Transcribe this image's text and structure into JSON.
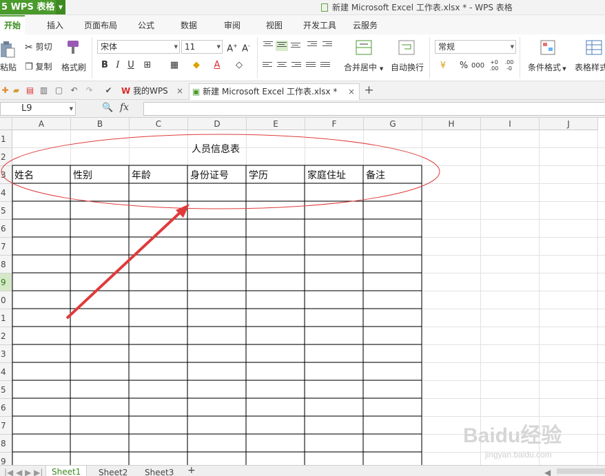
{
  "app": {
    "name": "WPS 表格",
    "window_title": "新建 Microsoft Excel 工作表.xlsx * - WPS 表格"
  },
  "menu": {
    "tabs": [
      "开始",
      "插入",
      "页面布局",
      "公式",
      "数据",
      "审阅",
      "视图",
      "开发工具",
      "云服务"
    ]
  },
  "ribbon": {
    "paste_label": "粘贴",
    "cut_label": "剪切",
    "copy_label": "复制",
    "format_painter_label": "格式刷",
    "font_name": "宋体",
    "font_size": "11",
    "bold": "B",
    "italic": "I",
    "underline": "U",
    "merge_center_label": "合并居中",
    "wrap_text_label": "自动换行",
    "number_format": "常规",
    "percent": "%",
    "conditional_format_label": "条件格式",
    "table_style_label": "表格样式"
  },
  "doc_tabs": {
    "my_wps": "我的WPS",
    "active_doc": "新建 Microsoft Excel 工作表.xlsx *"
  },
  "formula_bar": {
    "cell_ref": "L9",
    "fx": "fx",
    "formula": ""
  },
  "sheet": {
    "columns": [
      "A",
      "B",
      "C",
      "D",
      "E",
      "F",
      "G",
      "H",
      "I",
      "J"
    ],
    "rows": [
      "1",
      "2",
      "3",
      "4",
      "5",
      "6",
      "7",
      "8",
      "9",
      "0",
      "1",
      "2",
      "3",
      "4",
      "5",
      "6",
      "7",
      "8",
      "9"
    ],
    "active_row_index": 8,
    "table_title": "人员信息表",
    "headers": [
      "姓名",
      "性别",
      "年龄",
      "身份证号",
      "学历",
      "家庭住址",
      "备注"
    ]
  },
  "sheet_tabs": [
    "Sheet1",
    "Sheet2",
    "Sheet3"
  ],
  "watermark": {
    "brand": "Baidu经验",
    "url": "jingyan.baidu.com"
  },
  "colors": {
    "accent": "#4a9a2c",
    "annotation_red": "#e03a3a"
  }
}
